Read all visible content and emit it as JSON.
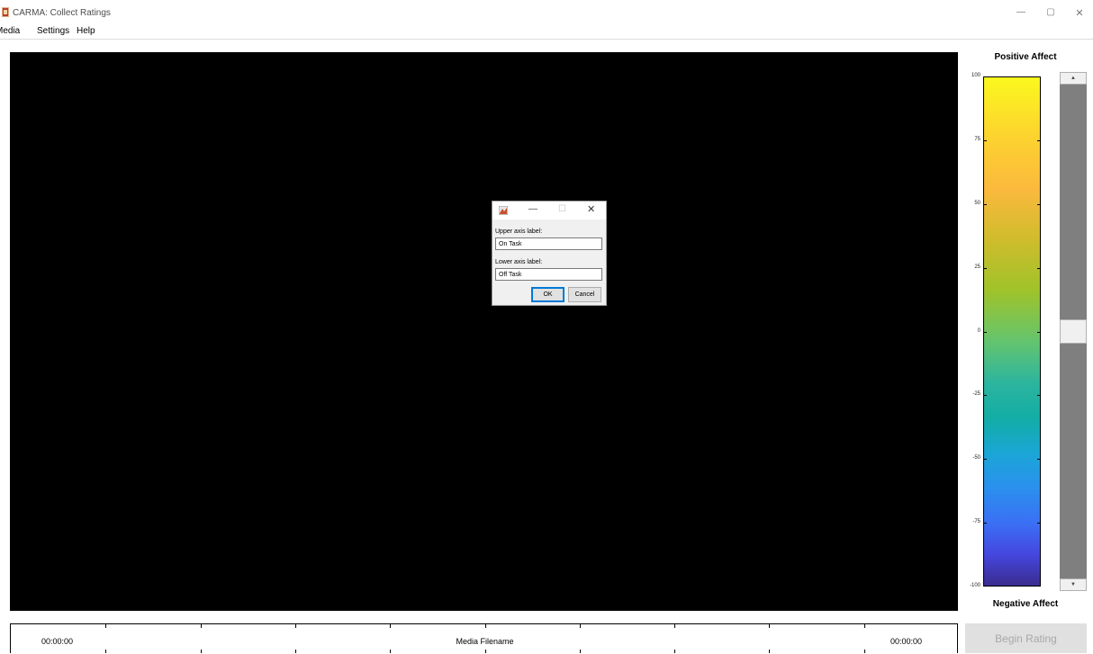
{
  "window": {
    "title": "CARMA: Collect Ratings",
    "minimize_glyph": "—",
    "maximize_glyph": "▢",
    "close_glyph": "✕"
  },
  "menu": {
    "items": [
      {
        "label": "Media"
      },
      {
        "label": "Settings"
      },
      {
        "label": "Help"
      }
    ]
  },
  "dialog": {
    "minimize_glyph": "—",
    "maximize_glyph": "☐",
    "close_glyph": "✕",
    "upper_label": "Upper axis label:",
    "upper_value": "On Task",
    "lower_label": "Lower axis label:",
    "lower_value": "Off Task",
    "ok_label": "OK",
    "cancel_label": "Cancel"
  },
  "rating": {
    "positive_label": "Positive Affect",
    "negative_label": "Negative Affect",
    "ticks": [
      "100",
      "75",
      "50",
      "25",
      "0",
      "-25",
      "-50",
      "-75",
      "-100"
    ],
    "scroll_up_glyph": "▲",
    "scroll_down_glyph": "▼",
    "slider_value": 0,
    "colormap": "parula"
  },
  "timeline": {
    "start_time": "00:00:00",
    "end_time": "00:00:00",
    "filename": "Media Filename"
  },
  "begin_button": {
    "label": "Begin Rating",
    "enabled": false
  }
}
